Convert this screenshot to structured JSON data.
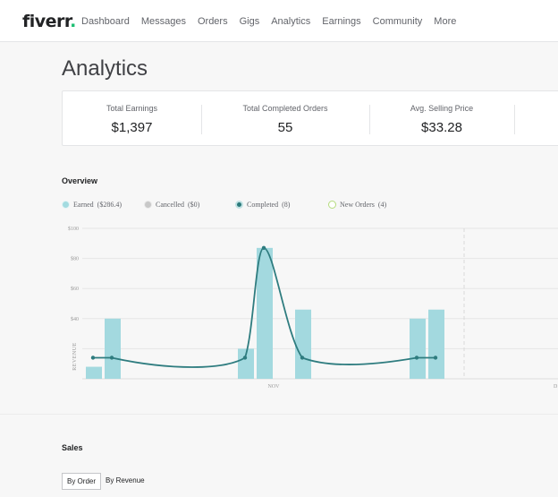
{
  "nav": {
    "logo": "fiverr",
    "logo_dot": ".",
    "links": [
      "Dashboard",
      "Messages",
      "Orders",
      "Gigs",
      "Analytics",
      "Earnings",
      "Community",
      "More"
    ]
  },
  "page_title": "Analytics",
  "stats": [
    {
      "label": "Total Earnings",
      "value": "$1,397"
    },
    {
      "label": "Total Completed Orders",
      "value": "55"
    },
    {
      "label": "Avg. Selling Price",
      "value": "$33.28"
    }
  ],
  "overview_title": "Overview",
  "legend": [
    {
      "name": "Earned",
      "amount": "($286.4)",
      "color": "#a3dbe0"
    },
    {
      "name": "Cancelled",
      "amount": "($0)",
      "color": "#c8c8c8"
    },
    {
      "name": "Completed",
      "amount": "(8)",
      "color": "#2c7a7b"
    },
    {
      "name": "New Orders",
      "amount": "(4)",
      "color": "#cde9a8"
    }
  ],
  "chart_data": {
    "type": "bar",
    "ylabel": "REVENUE",
    "yticks": [
      "$100",
      "$80",
      "$60",
      "$40"
    ],
    "ylim": [
      0,
      100
    ],
    "xticks": [
      "NOV",
      "D"
    ],
    "grid": true,
    "bar_color": "#a3d9df",
    "line_color": "#2e7c7f",
    "bars": [
      8,
      40,
      20,
      87,
      46,
      40,
      46
    ],
    "line": [
      14,
      14,
      14,
      87,
      14,
      14,
      14
    ]
  },
  "sales_title": "Sales",
  "tabs": [
    "By Order",
    "By Revenue"
  ]
}
